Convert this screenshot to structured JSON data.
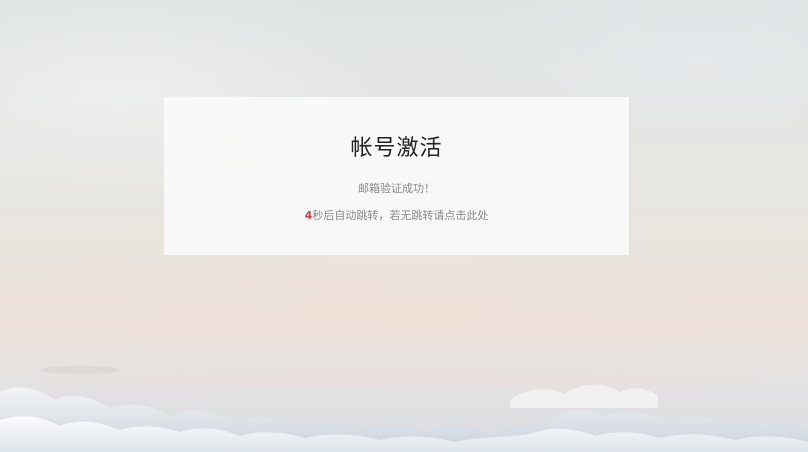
{
  "activation": {
    "title": "帐号激活",
    "message": "邮箱验证成功！",
    "countdown": "4",
    "redirect_text": "秒后自动跳转，若无跳转请",
    "redirect_link": "点击此处"
  },
  "colors": {
    "countdown": "#e23b3b",
    "text_muted": "#8a8a8a",
    "title": "#222222"
  }
}
